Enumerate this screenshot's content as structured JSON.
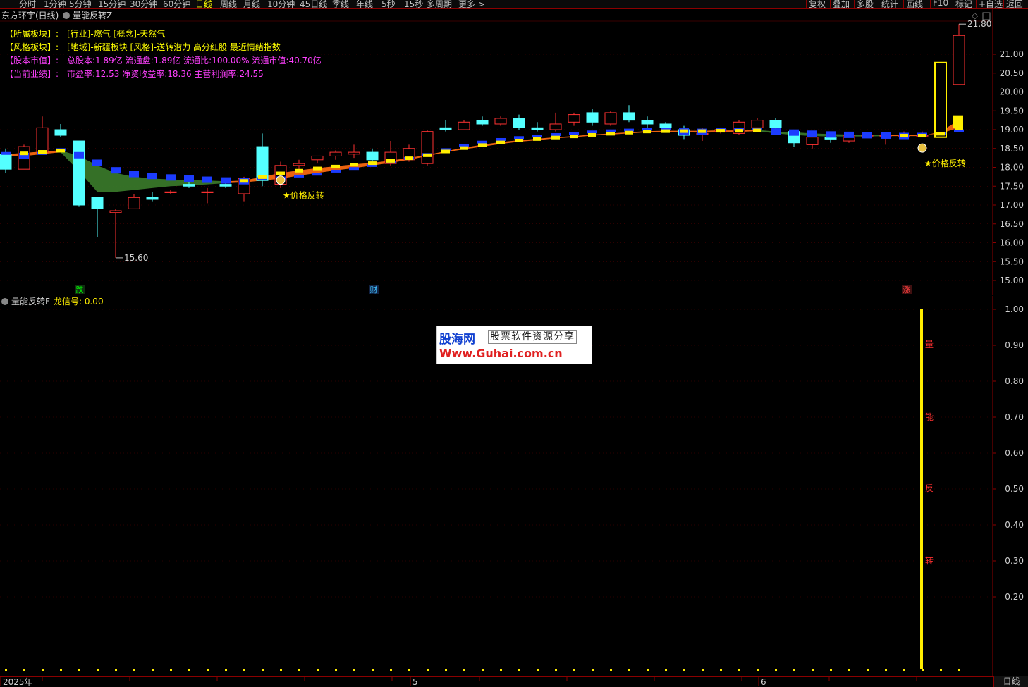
{
  "toolbar": {
    "items": [
      "分时",
      "1分钟",
      "5分钟",
      "15分钟",
      "30分钟",
      "60分钟",
      "日线",
      "周线",
      "月线",
      "10分钟",
      "45日线",
      "季线",
      "年线",
      "5秒",
      "15秒",
      "多周期",
      "更多 >"
    ],
    "active": "日线",
    "right_items": [
      "复权",
      "叠加",
      "多股",
      "统计",
      "画线",
      "F10",
      "标记",
      "+自选",
      "返回"
    ]
  },
  "main": {
    "stock_title": "东方环宇(日线)",
    "indicator_name": "量能反转Z",
    "info_lines": [
      {
        "label": "【所属板块】:",
        "value": "[行业]-燃气 [概念]-天然气",
        "color": "#ffff00"
      },
      {
        "label": "【风格板块】:",
        "value": "[地域]-新疆板块 [风格]-送转潜力 高分红股 最近情绪指数",
        "color": "#ffff00"
      },
      {
        "label": "【股本市值】:",
        "value": "总股本:1.89亿 流通盘:1.89亿 流通比:100.00% 流通市值:40.70亿",
        "color": "#ff40ff"
      },
      {
        "label": "【当前业绩】:",
        "value": "市盈率:12.53 净资收益率:18.36 主营利润率:24.55",
        "color": "#ff40ff"
      }
    ],
    "y_ticks": [
      "21.00",
      "20.50",
      "20.00",
      "19.50",
      "19.00",
      "18.50",
      "18.00",
      "17.50",
      "17.00",
      "16.50",
      "16.00",
      "15.50",
      "15.00"
    ],
    "max_label": "21.80",
    "min_label": "15.60",
    "signal_text": "★价格反转",
    "markers": [
      {
        "text": "跌",
        "color": "#00ff00",
        "bg": "#103010"
      },
      {
        "text": "财",
        "color": "#40c0ff",
        "bg": "#102040"
      },
      {
        "text": "涨",
        "color": "#ff4040",
        "bg": "#401010"
      }
    ]
  },
  "sub": {
    "indicator_name": "量能反转F",
    "signal_label": "龙信号: 0.00",
    "y_ticks": [
      "1.00",
      "0.90",
      "0.80",
      "0.70",
      "0.60",
      "0.50",
      "0.40",
      "0.30",
      "0.20"
    ],
    "vertical_text": [
      "量",
      "能",
      "反",
      "转"
    ]
  },
  "watermark": {
    "logo": "股海网",
    "slogan": "股票软件资源分享",
    "url": "Www.Guhai.com.cn"
  },
  "x_axis": {
    "labels": [
      "2025年",
      "5",
      "6"
    ],
    "period_tab": "日线"
  },
  "chart_data": {
    "type": "candlestick",
    "y_unit": "price",
    "ylim": [
      14.8,
      22.0
    ],
    "candles": [
      {
        "o": 18.35,
        "h": 18.5,
        "l": 17.85,
        "c": 17.95
      },
      {
        "o": 17.95,
        "h": 18.6,
        "l": 17.95,
        "c": 18.55
      },
      {
        "o": 18.4,
        "h": 19.35,
        "l": 18.4,
        "c": 19.05
      },
      {
        "o": 19.0,
        "h": 19.15,
        "l": 18.8,
        "c": 18.85
      },
      {
        "o": 18.7,
        "h": 18.7,
        "l": 16.95,
        "c": 17.0
      },
      {
        "o": 17.2,
        "h": 17.2,
        "l": 16.15,
        "c": 16.9
      },
      {
        "o": 16.8,
        "h": 16.9,
        "l": 15.6,
        "c": 16.85
      },
      {
        "o": 16.9,
        "h": 17.3,
        "l": 16.9,
        "c": 17.2
      },
      {
        "o": 17.2,
        "h": 17.35,
        "l": 17.1,
        "c": 17.15
      },
      {
        "o": 17.35,
        "h": 17.4,
        "l": 17.3,
        "c": 17.35
      },
      {
        "o": 17.55,
        "h": 17.6,
        "l": 17.45,
        "c": 17.5
      },
      {
        "o": 17.35,
        "h": 17.45,
        "l": 17.05,
        "c": 17.35
      },
      {
        "o": 17.55,
        "h": 17.65,
        "l": 17.45,
        "c": 17.5
      },
      {
        "o": 17.3,
        "h": 17.75,
        "l": 17.1,
        "c": 17.7
      },
      {
        "o": 18.55,
        "h": 18.9,
        "l": 17.5,
        "c": 17.65
      },
      {
        "o": 17.55,
        "h": 18.15,
        "l": 17.45,
        "c": 18.05
      },
      {
        "o": 18.05,
        "h": 18.2,
        "l": 17.95,
        "c": 18.1
      },
      {
        "o": 18.2,
        "h": 18.3,
        "l": 18.1,
        "c": 18.3
      },
      {
        "o": 18.3,
        "h": 18.45,
        "l": 18.2,
        "c": 18.4
      },
      {
        "o": 18.35,
        "h": 18.6,
        "l": 18.25,
        "c": 18.4
      },
      {
        "o": 18.4,
        "h": 18.5,
        "l": 18.1,
        "c": 18.2
      },
      {
        "o": 18.1,
        "h": 18.7,
        "l": 18.05,
        "c": 18.4
      },
      {
        "o": 18.2,
        "h": 18.6,
        "l": 18.15,
        "c": 18.5
      },
      {
        "o": 18.1,
        "h": 19.0,
        "l": 18.05,
        "c": 18.95
      },
      {
        "o": 19.05,
        "h": 19.25,
        "l": 18.95,
        "c": 19.0
      },
      {
        "o": 19.0,
        "h": 19.25,
        "l": 19.0,
        "c": 19.2
      },
      {
        "o": 19.25,
        "h": 19.35,
        "l": 19.1,
        "c": 19.15
      },
      {
        "o": 19.15,
        "h": 19.35,
        "l": 19.1,
        "c": 19.3
      },
      {
        "o": 19.3,
        "h": 19.4,
        "l": 19.0,
        "c": 19.05
      },
      {
        "o": 19.05,
        "h": 19.2,
        "l": 18.95,
        "c": 19.0
      },
      {
        "o": 19.0,
        "h": 19.45,
        "l": 18.95,
        "c": 19.15
      },
      {
        "o": 19.2,
        "h": 19.45,
        "l": 19.1,
        "c": 19.4
      },
      {
        "o": 19.45,
        "h": 19.55,
        "l": 19.1,
        "c": 19.2
      },
      {
        "o": 19.15,
        "h": 19.5,
        "l": 19.1,
        "c": 19.45
      },
      {
        "o": 19.45,
        "h": 19.65,
        "l": 19.2,
        "c": 19.25
      },
      {
        "o": 19.25,
        "h": 19.35,
        "l": 19.05,
        "c": 19.15
      },
      {
        "o": 19.15,
        "h": 19.2,
        "l": 19.0,
        "c": 19.05
      },
      {
        "o": 19.0,
        "h": 19.1,
        "l": 18.75,
        "c": 18.85
      },
      {
        "o": 18.9,
        "h": 19.05,
        "l": 18.7,
        "c": 18.9
      },
      {
        "o": 18.95,
        "h": 19.05,
        "l": 18.9,
        "c": 19.0
      },
      {
        "o": 18.9,
        "h": 19.25,
        "l": 18.85,
        "c": 19.2
      },
      {
        "o": 19.05,
        "h": 19.3,
        "l": 19.0,
        "c": 19.25
      },
      {
        "o": 19.25,
        "h": 19.3,
        "l": 18.95,
        "c": 19.05
      },
      {
        "o": 18.95,
        "h": 19.0,
        "l": 18.55,
        "c": 18.65
      },
      {
        "o": 18.6,
        "h": 18.85,
        "l": 18.5,
        "c": 18.8
      },
      {
        "o": 18.8,
        "h": 18.9,
        "l": 18.65,
        "c": 18.75
      },
      {
        "o": 18.7,
        "h": 18.9,
        "l": 18.65,
        "c": 18.85
      },
      {
        "o": 18.85,
        "h": 18.9,
        "l": 18.8,
        "c": 18.85
      },
      {
        "o": 18.85,
        "h": 18.9,
        "l": 18.6,
        "c": 18.85
      },
      {
        "o": 18.85,
        "h": 18.95,
        "l": 18.8,
        "c": 18.85
      },
      {
        "o": 18.85,
        "h": 18.95,
        "l": 18.8,
        "c": 18.85
      },
      {
        "o": 18.8,
        "h": 20.78,
        "l": 18.8,
        "c": 20.78
      },
      {
        "o": 20.2,
        "h": 21.8,
        "l": 20.4,
        "c": 21.5
      }
    ],
    "ma_yellow": [
      18.35,
      18.38,
      18.42,
      18.45,
      18.3,
      18.05,
      17.85,
      17.75,
      17.7,
      17.68,
      17.66,
      17.65,
      17.63,
      17.65,
      17.75,
      17.85,
      17.92,
      17.98,
      18.03,
      18.08,
      18.12,
      18.18,
      18.25,
      18.33,
      18.43,
      18.52,
      18.6,
      18.67,
      18.72,
      18.76,
      18.8,
      18.83,
      18.87,
      18.9,
      18.93,
      18.96,
      18.97,
      18.97,
      18.97,
      18.98,
      18.98,
      18.99,
      18.95,
      18.93,
      18.9,
      18.88,
      18.87,
      18.86,
      18.85,
      18.85,
      18.85,
      18.9,
      19.05
    ],
    "ma_blue": [
      18.35,
      18.33,
      18.35,
      18.45,
      18.35,
      18.15,
      17.95,
      17.85,
      17.8,
      17.76,
      17.73,
      17.7,
      17.68,
      17.66,
      17.68,
      17.7,
      17.75,
      17.8,
      17.88,
      17.95,
      18.03,
      18.12,
      18.22,
      18.32,
      18.45,
      18.56,
      18.65,
      18.72,
      18.77,
      18.81,
      18.85,
      18.88,
      18.92,
      18.95,
      18.97,
      18.99,
      19.0,
      18.98,
      18.97,
      18.98,
      18.99,
      19.0,
      18.98,
      18.95,
      18.92,
      18.9,
      18.89,
      18.88,
      18.87,
      18.86,
      18.86,
      18.88,
      18.95
    ],
    "band_lower": [
      18.3,
      18.3,
      18.35,
      18.4,
      17.9,
      17.35,
      17.35,
      17.4,
      17.45,
      17.5,
      17.52,
      17.55,
      17.58,
      17.6,
      17.65,
      17.7,
      17.78,
      17.85,
      17.92,
      17.98,
      18.05,
      18.12,
      18.2,
      18.3,
      18.4,
      18.48,
      18.55,
      18.62,
      18.68,
      18.72,
      18.77,
      18.8,
      18.84,
      18.87,
      18.9,
      18.93,
      18.94,
      18.93,
      18.92,
      18.93,
      18.94,
      18.96,
      18.9,
      18.86,
      18.83,
      18.82,
      18.82,
      18.82,
      18.83,
      18.83,
      18.83,
      18.95,
      19.25
    ],
    "sub_series": {
      "value_label": 1.0,
      "signal_bar_index": 50,
      "dots_count": 53
    }
  }
}
